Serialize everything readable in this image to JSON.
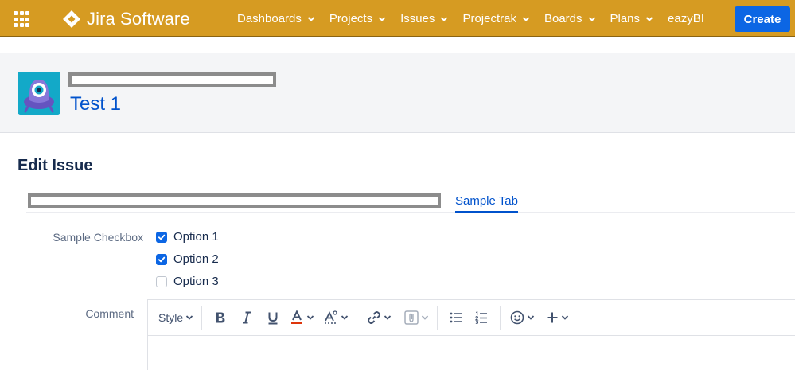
{
  "topnav": {
    "brand": "Jira Software",
    "menu": [
      {
        "label": "Dashboards",
        "has_dropdown": true
      },
      {
        "label": "Projects",
        "has_dropdown": true
      },
      {
        "label": "Issues",
        "has_dropdown": true
      },
      {
        "label": "Projectrak",
        "has_dropdown": true
      },
      {
        "label": "Boards",
        "has_dropdown": true
      },
      {
        "label": "Plans",
        "has_dropdown": true
      },
      {
        "label": "eazyBI",
        "has_dropdown": false
      }
    ],
    "create_label": "Create",
    "colors": {
      "bar": "#d69b22",
      "create": "#0c66e4"
    }
  },
  "header": {
    "issue_title": "Test 1",
    "avatar_icon": "project-avatar-icon"
  },
  "edit": {
    "title": "Edit Issue",
    "tab": "Sample Tab",
    "checkbox_label": "Sample Checkbox",
    "options": [
      {
        "label": "Option 1",
        "checked": true
      },
      {
        "label": "Option 2",
        "checked": true
      },
      {
        "label": "Option 3",
        "checked": false
      }
    ],
    "comment_label": "Comment",
    "toolbar": {
      "style_label": "Style",
      "icons": [
        "bold-icon",
        "italic-icon",
        "underline-icon",
        "text-color-icon",
        "text-effects-icon",
        "link-icon",
        "attachment-icon",
        "bullet-list-icon",
        "numbered-list-icon",
        "emoji-icon",
        "insert-more-icon"
      ]
    }
  }
}
